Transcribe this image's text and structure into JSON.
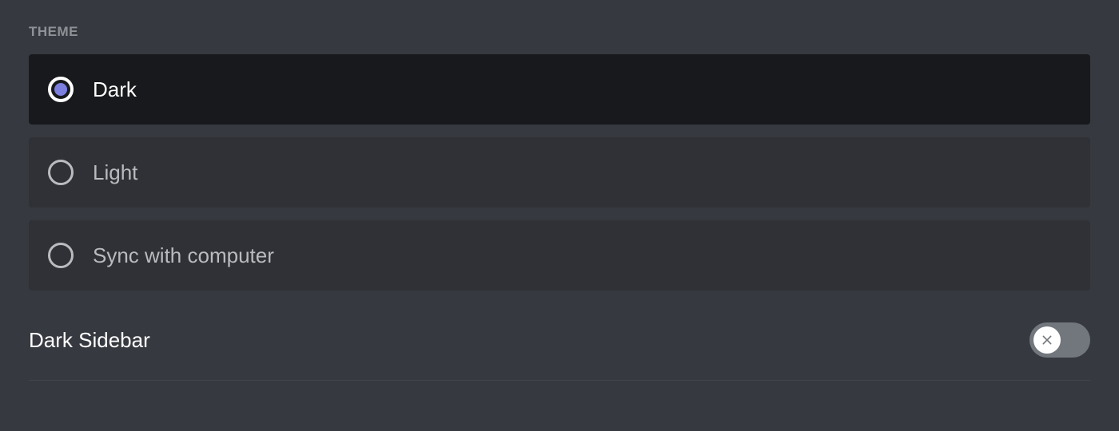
{
  "section": {
    "header": "THEME"
  },
  "theme_options": {
    "dark": "Dark",
    "light": "Light",
    "sync": "Sync with computer"
  },
  "toggle": {
    "dark_sidebar_label": "Dark Sidebar"
  },
  "colors": {
    "background": "#36393f",
    "option_bg": "#2f3136",
    "option_selected_bg": "#18191c",
    "accent": "#7c7fde",
    "text_primary": "#ffffff",
    "text_muted": "#b9bbbe",
    "header_text": "#8e9297",
    "toggle_off": "#72767d"
  }
}
